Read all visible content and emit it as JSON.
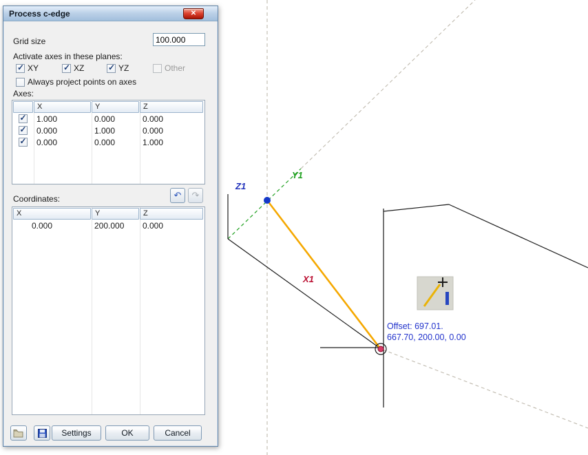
{
  "window": {
    "title": "Process c-edge",
    "close_glyph": "✕"
  },
  "icons": {
    "undo": "↶",
    "redo": "↷"
  },
  "dialog": {
    "grid_size": {
      "label": "Grid size",
      "value": "100.000"
    },
    "activate_axes_label": "Activate axes in these planes:",
    "plane_checkboxes": [
      {
        "label": "XY",
        "checked": true,
        "disabled": false
      },
      {
        "label": "XZ",
        "checked": true,
        "disabled": false
      },
      {
        "label": "YZ",
        "checked": true,
        "disabled": false
      },
      {
        "label": "Other",
        "checked": false,
        "disabled": true
      }
    ],
    "project_checkbox_label": "Always project points on axes",
    "axes_section": {
      "label": "Axes:",
      "headers": [
        "X",
        "Y",
        "Z"
      ],
      "row_checked": [
        true,
        true,
        true
      ],
      "rows": [
        [
          "1.000",
          "0.000",
          "0.000"
        ],
        [
          "0.000",
          "1.000",
          "0.000"
        ],
        [
          "0.000",
          "0.000",
          "1.000"
        ]
      ]
    },
    "coordinates_section": {
      "label": "Coordinates:",
      "headers": [
        "X",
        "Y",
        "Z"
      ],
      "rows": [
        [
          "0.000",
          "200.000",
          "0.000"
        ]
      ]
    },
    "footer": {
      "settings": "Settings",
      "ok": "OK",
      "cancel": "Cancel"
    }
  },
  "viewport": {
    "axis_labels": {
      "x": "X1",
      "y": "Y1",
      "z": "Z1"
    },
    "offset_text": [
      "Offset: 697.01.",
      "667.70, 200.00, 0.00"
    ],
    "colors": {
      "x_axis_label": "#bb1133",
      "y_axis": "#1fa01f",
      "z_axis_label": "#2233bb",
      "edge_preview": "#f5a800",
      "snap_point": "#1538c8",
      "end_marker": "#d83a66",
      "offset_text": "#2233cc",
      "construction_line": "#b9b3a6"
    }
  }
}
